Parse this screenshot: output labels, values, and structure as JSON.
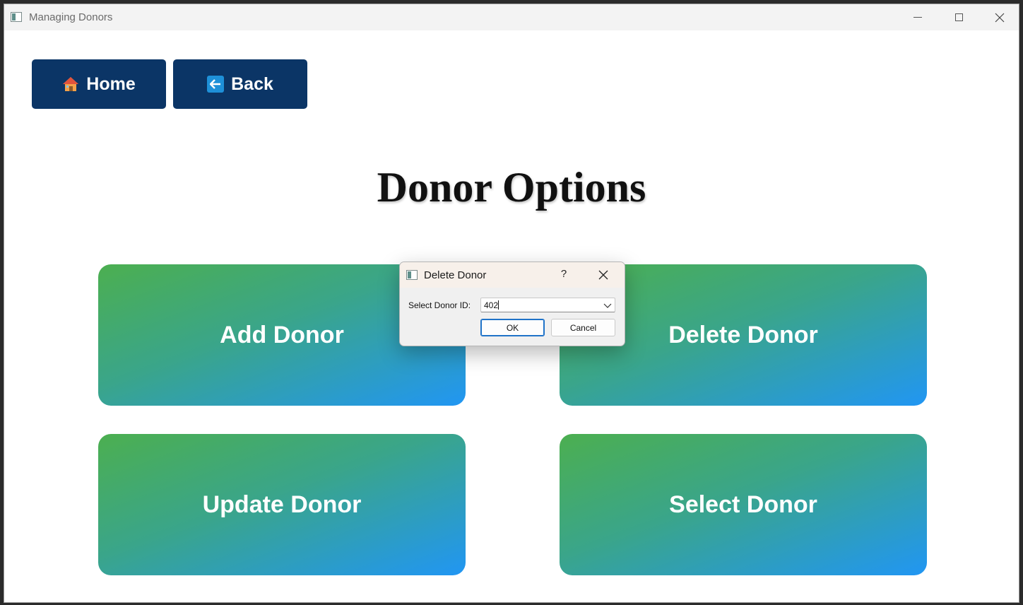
{
  "window": {
    "title": "Managing Donors",
    "icon": "app-window-icon"
  },
  "nav": {
    "home_label": "Home",
    "home_icon": "house-icon",
    "back_label": "Back",
    "back_icon": "left-arrow-icon"
  },
  "page": {
    "title": "Donor Options"
  },
  "options": {
    "add": "Add Donor",
    "delete": "Delete Donor",
    "update": "Update Donor",
    "select": "Select Donor"
  },
  "dialog": {
    "title": "Delete Donor",
    "help": "?",
    "label": "Select Donor ID:",
    "combo_value": "402",
    "ok_label": "OK",
    "cancel_label": "Cancel"
  },
  "colors": {
    "nav_button": "#0b3566",
    "gradient_start": "#4caf50",
    "gradient_end": "#2196f3"
  }
}
